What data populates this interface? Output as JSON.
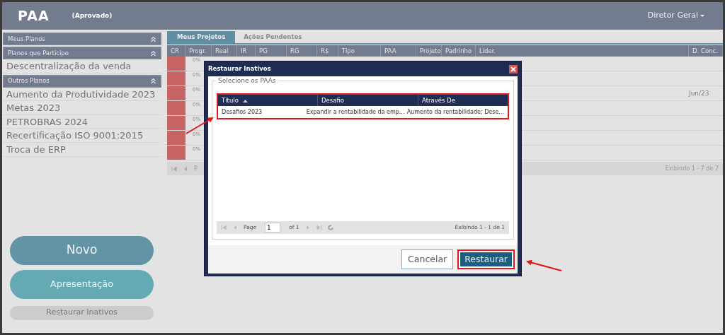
{
  "header": {
    "title": "PAA",
    "status": "(Aprovado)",
    "user_menu": "Diretor Geral"
  },
  "sidebar": {
    "sections": [
      {
        "title": "Meus Planos"
      },
      {
        "title": "Planos que Participo",
        "items": [
          "Descentralização da venda"
        ]
      },
      {
        "title": "Outros Planos",
        "items": [
          "Aumento da Produtividade 2023",
          "Metas 2023",
          "PETROBRAS 2024",
          "Recertificação ISO 9001:2015",
          "Troca de ERP"
        ]
      }
    ],
    "buttons": [
      {
        "label": "Novo",
        "kind": "large"
      },
      {
        "label": "Apresentação",
        "kind": "medium"
      },
      {
        "label": "Restaurar Inativos",
        "kind": "small"
      }
    ]
  },
  "tabs": [
    {
      "label": "Meus Projetos",
      "selected": true
    },
    {
      "label": "Ações Pendentes",
      "selected": false
    }
  ],
  "table": {
    "columns": [
      "CR",
      "Progr.",
      "Real",
      "IR",
      "PG",
      "RG",
      "R$",
      "Tipo",
      "PAA",
      "Projeto",
      "Padrinho",
      "Líder.",
      "D. Conc."
    ],
    "rows": [
      {
        "color": "#c96464",
        "progress": "0%"
      },
      {
        "color": "#c96464",
        "progress": "0%"
      },
      {
        "color": "#c96464",
        "progress": "0%",
        "date": "Jun/23"
      },
      {
        "color": "#c96464",
        "progress": "0%"
      },
      {
        "color": "#c96464",
        "progress": "0%"
      },
      {
        "color": "#c96464",
        "progress": "0%"
      },
      {
        "color": "#c96464",
        "progress": "0%"
      }
    ],
    "pager": {
      "page_label": "P",
      "summary": "Exibindo 1 - 7 de 7"
    }
  },
  "dialog": {
    "title": "Restaurar Inativos",
    "group_label": "Selecione os PAAs",
    "columns": [
      {
        "label": "Título",
        "sorted": true
      },
      {
        "label": "Desafio",
        "sorted": false
      },
      {
        "label": "Através De",
        "sorted": false
      }
    ],
    "rows": [
      [
        "Desafios 2023",
        "Expandir a rentabilidade da emp...",
        "Aumento da rentabilidade; Dese..."
      ]
    ],
    "grid_annotated": true,
    "pager": {
      "page_label": "Page",
      "page_value": "1",
      "page_count": "of 1",
      "summary": "Exibindo 1 - 1 de 1"
    },
    "buttons": [
      {
        "label": "Cancelar",
        "kind": "secondary",
        "annotated": false
      },
      {
        "label": "Restaurar",
        "kind": "primary",
        "annotated": true
      }
    ]
  }
}
